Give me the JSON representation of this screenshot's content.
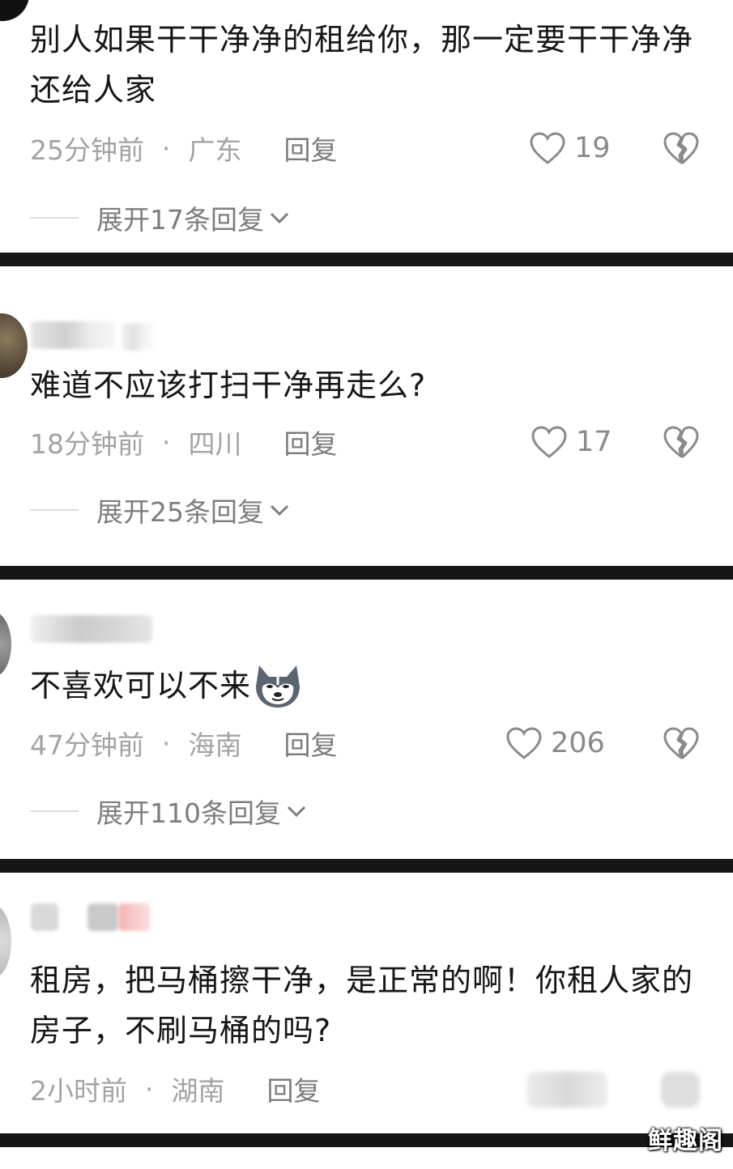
{
  "comments": [
    {
      "text": "别人如果干干净净的租给你，那一定要干干净净还给人家",
      "time": "25分钟前",
      "location": "广东",
      "reply_label": "回复",
      "likes": "19",
      "expand_label": "展开17条回复"
    },
    {
      "text": "难道不应该打扫干净再走么?",
      "time": "18分钟前",
      "location": "四川",
      "reply_label": "回复",
      "likes": "17",
      "expand_label": "展开25条回复"
    },
    {
      "text": "不喜欢可以不来",
      "emoji_icon": "husky-dog-face-icon",
      "time": "47分钟前",
      "location": "海南",
      "reply_label": "回复",
      "likes": "206",
      "expand_label": "展开110条回复"
    },
    {
      "text": "租房，把马桶擦干净，是正常的啊！你租人家的房子，不刷马桶的吗?",
      "time": "2小时前",
      "location": "湖南",
      "reply_label": "回复"
    }
  ],
  "meta_separator": "·",
  "watermark": "鲜趣阁",
  "colors": {
    "divider_bar": "#161616",
    "body_text": "#161616",
    "meta_text": "#a3a3a3"
  }
}
